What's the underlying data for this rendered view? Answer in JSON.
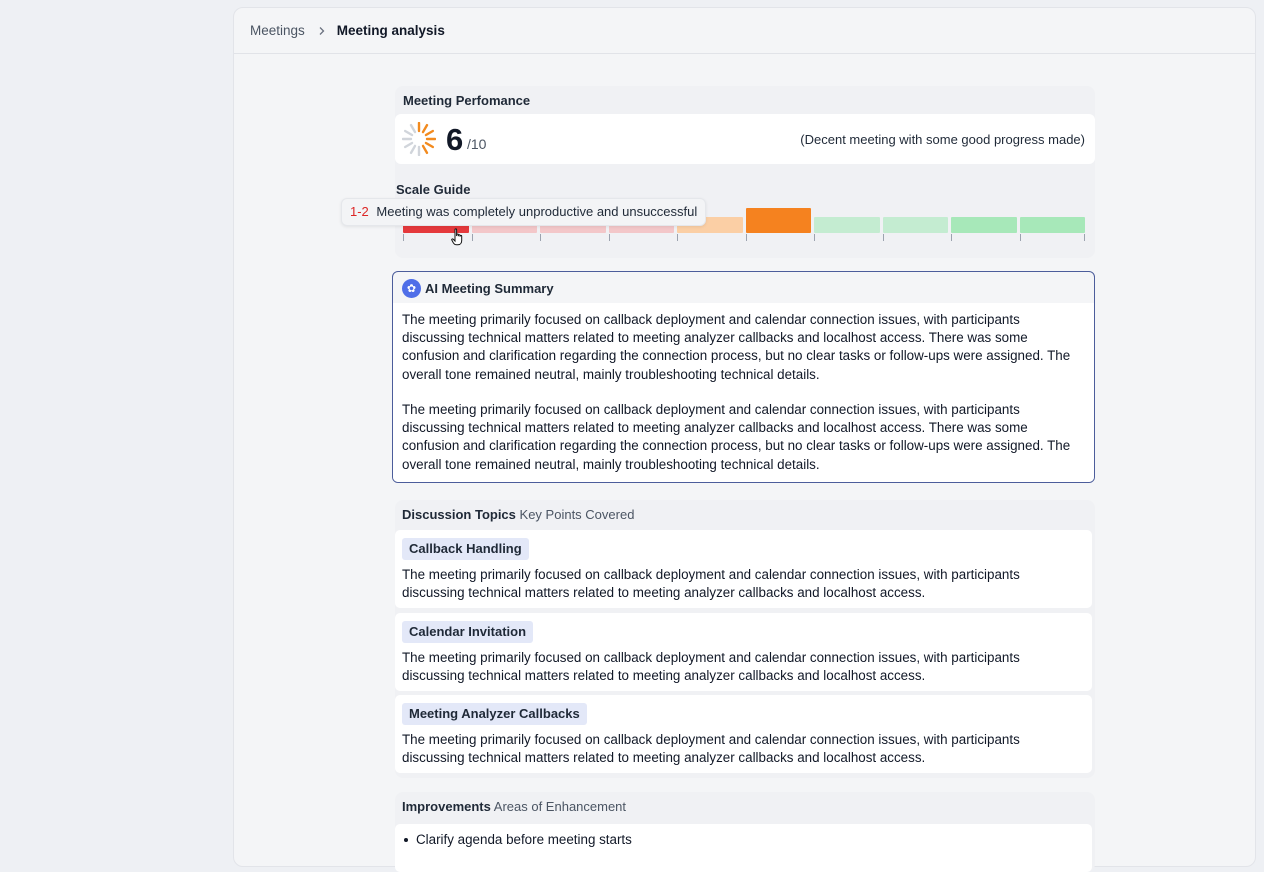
{
  "breadcrumb": {
    "parent": "Meetings",
    "current": "Meeting analysis"
  },
  "performance": {
    "title": "Meeting Perfomance",
    "score": "6",
    "score_max": "/10",
    "description": "(Decent meeting with some good progress made)",
    "scale_title": "Scale Guide",
    "scale_segment_colors": [
      "#e5393c",
      "#f3c7c9",
      "#f3c7c9",
      "#f3c7c9",
      "#fbcfa5",
      "#f5821f",
      "#c4ecd1",
      "#c4ecd1",
      "#a7e8b9",
      "#a7e8b9"
    ],
    "highlighted_segment": 6,
    "tooltip": {
      "range": "1-2",
      "text": "Meeting was completely unproductive and unsuccessful"
    }
  },
  "summary": {
    "icon": "brain-icon",
    "title": "AI Meeting Summary",
    "paragraphs": [
      "The meeting primarily focused on callback deployment and calendar connection issues, with participants discussing technical matters related to meeting analyzer callbacks and localhost access. There was some confusion and clarification regarding the connection process, but no clear tasks or follow-ups were assigned. The overall tone remained neutral, mainly troubleshooting technical details.",
      "The meeting primarily focused on callback deployment and calendar connection issues, with participants discussing technical matters related to meeting analyzer callbacks and localhost access. There was some confusion and clarification regarding the connection process, but no clear tasks or follow-ups were assigned. The overall tone remained neutral, mainly troubleshooting technical details."
    ]
  },
  "topics": {
    "title": "Discussion Topics",
    "subtitle": "Key Points Covered",
    "items": [
      {
        "tag": "Callback Handling",
        "text": "The meeting primarily focused on callback deployment and calendar connection issues, with participants discussing technical matters related to meeting analyzer callbacks and localhost access."
      },
      {
        "tag": "Calendar Invitation",
        "text": "The meeting primarily focused on callback deployment and calendar connection issues, with participants discussing technical matters related to meeting analyzer callbacks and localhost access."
      },
      {
        "tag": "Meeting Analyzer Callbacks",
        "text": "The meeting primarily focused on callback deployment and calendar connection issues, with participants discussing technical matters related to meeting analyzer callbacks and localhost access."
      }
    ]
  },
  "improvements": {
    "title": "Improvements",
    "subtitle": "Areas of Enhancement",
    "items": [
      "Clarify agenda before meeting starts"
    ]
  }
}
